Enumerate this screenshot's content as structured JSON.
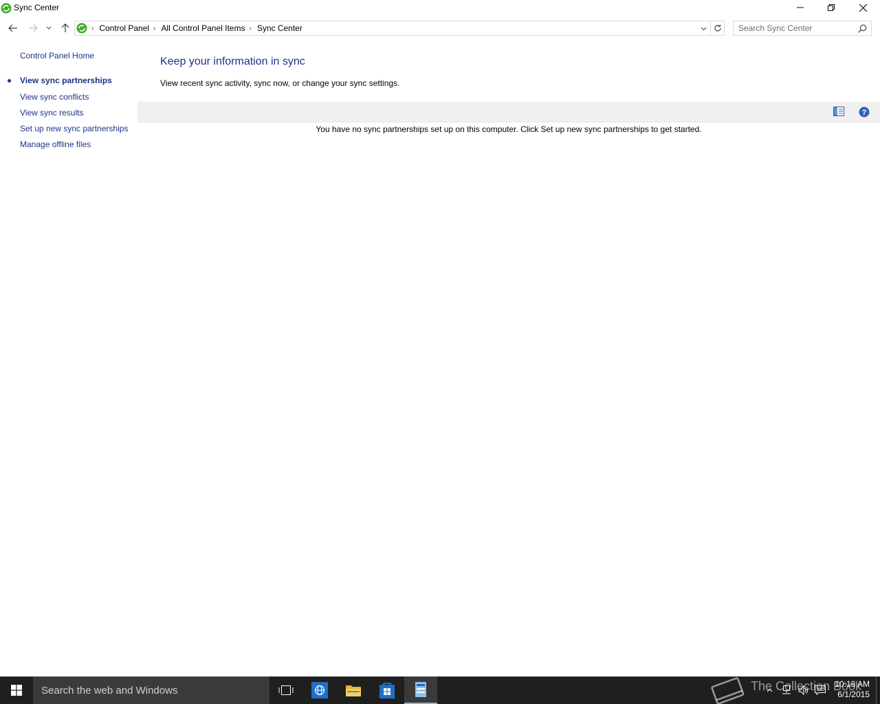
{
  "window": {
    "title": "Sync Center"
  },
  "breadcrumb": {
    "items": [
      "Control Panel",
      "All Control Panel Items",
      "Sync Center"
    ]
  },
  "search": {
    "placeholder": "Search Sync Center"
  },
  "left_pane": {
    "home_link": "Control Panel Home",
    "tasks": [
      {
        "label": "View sync partnerships",
        "active": true
      },
      {
        "label": "View sync conflicts",
        "active": false
      },
      {
        "label": "View sync results",
        "active": false
      },
      {
        "label": "Set up new sync partnerships",
        "active": false
      },
      {
        "label": "Manage offline files",
        "active": false
      }
    ]
  },
  "main": {
    "title": "Keep your information in sync",
    "description": "View recent sync activity, sync now, or change your sync settings.",
    "empty_message": "You have no sync partnerships set up on this computer. Click Set up new sync partnerships to get started."
  },
  "taskbar": {
    "search_text": "Search the web and Windows",
    "clock_time": "10:18 AM",
    "clock_date": "6/1/2015",
    "watermark": "The Collection Book"
  },
  "colors": {
    "link": "#1e3287",
    "title_blue": "#1e3287",
    "toolbar_bg": "#f0f0f0",
    "taskbar_bg": "#1f1f1f",
    "taskbar_search_bg": "#3b3b3b"
  },
  "icons": [
    "sync-center-icon",
    "minimize-icon",
    "maximize-icon",
    "close-icon",
    "back-arrow-icon",
    "forward-arrow-icon",
    "chevron-down-icon",
    "up-arrow-icon",
    "refresh-icon",
    "search-icon",
    "preview-pane-icon",
    "help-icon",
    "windows-logo-icon",
    "task-view-icon",
    "internet-explorer-icon",
    "file-explorer-icon",
    "store-icon",
    "control-panel-icon"
  ]
}
